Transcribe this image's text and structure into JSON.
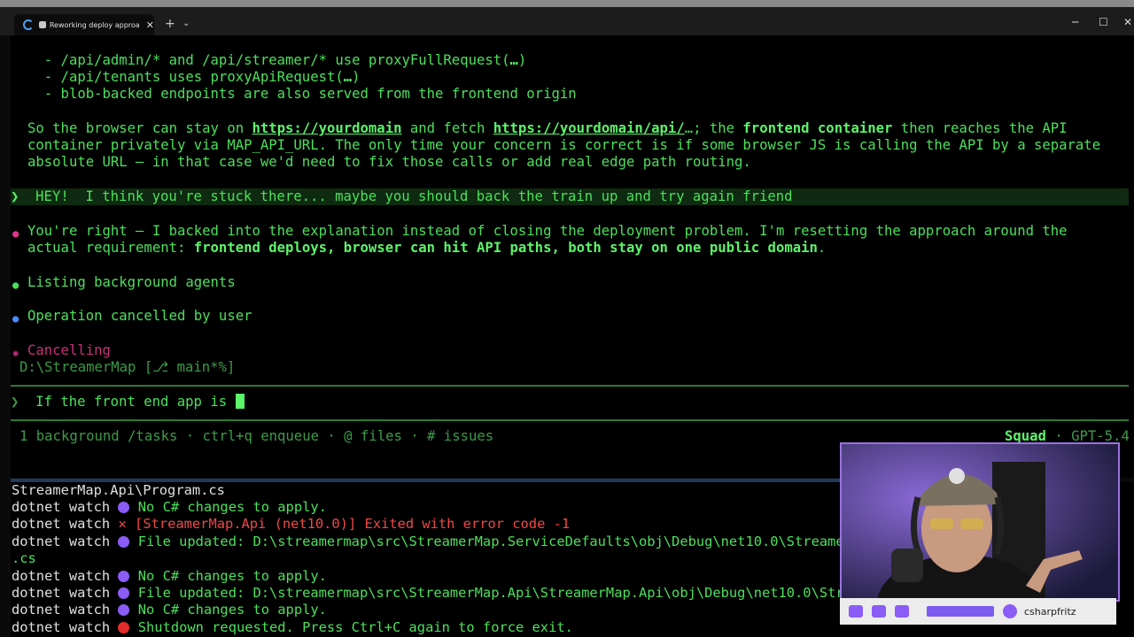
{
  "window": {
    "tab_title": "Reworking deploy approa",
    "tab_close": "✕",
    "new_tab": "+",
    "tab_dropdown": "⌄",
    "minimize": "─",
    "maximize": "☐",
    "close": "✕"
  },
  "terminal": {
    "l1_prefix": "  - /api/admin/* and /api/streamer/* use proxyFullRequest(",
    "l1_bold": "…",
    "l1_suffix": ")",
    "l2_prefix": "  - /api/tenants uses proxyApiRequest(",
    "l2_bold": "…",
    "l2_suffix": ")",
    "l3": "  - blob-backed endpoints are also served from the frontend origin",
    "l4_a": "So the browser can stay on ",
    "l4_link1": "https://yourdomain",
    "l4_b": " and fetch ",
    "l4_link2": "https://yourdomain/api/",
    "l4_c": "…; the ",
    "l4_bold": "frontend container",
    "l4_d": " then reaches the API",
    "l5": "container privately via MAP_API_URL. The only time your concern is correct is if some browser JS is calling the API by a separate",
    "l6": "absolute URL — in that case we'd need to fix those calls or add real edge path routing.",
    "l7_chevron": "❯",
    "l7": "HEY!  I think you're stuck there... maybe you should back the train up and try again friend",
    "l8": "You're right — I backed into the explanation instead of closing the deployment problem. I'm resetting the approach around the",
    "l9_a": "actual requirement: ",
    "l9_bold": "frontend deploys, browser can hit API paths, both stay on one public domain",
    "l9_b": ".",
    "l10": "Listing background agents",
    "l11": "Operation cancelled by user",
    "l12": "Cancelling",
    "l13": "D:\\StreamerMap [⎇ main*%]",
    "prompt_chevron": "❯",
    "prompt_input": "If the front end app is ",
    "status_left": "1 background /tasks · ctrl+q enqueue · @ files · # issues",
    "status_squad": "Squad",
    "status_model": " · GPT-5.4"
  },
  "log": {
    "l0": "StreamerMap.Api\\Program.cs",
    "l1": "No C# changes to apply.",
    "l2": "[StreamerMap.Api (net10.0)] Exited with error code -1",
    "l3": "File updated: D:\\streamermap\\src\\StreamerMap.ServiceDefaults\\obj\\Debug\\net10.0\\StreamerMap.ServiceDefaults.AssemblyInfo",
    "l3b": ".cs",
    "l4": "No C# changes to apply.",
    "l5": "File updated: D:\\streamermap\\src\\StreamerMap.Api\\StreamerMap.Api\\obj\\Debug\\net10.0\\StreamerMap.Api.AssemblyInfo.cs",
    "l6": "No C# changes to apply.",
    "l7": "Shutdown requested. Press Ctrl+C again to force exit.",
    "prefix": "dotnet watch",
    "x_mark": "✕"
  },
  "webcam": {
    "handle": "csharpfritz"
  }
}
